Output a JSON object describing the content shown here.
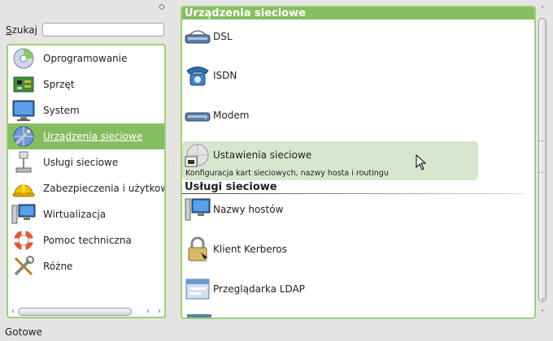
{
  "left_panel": {
    "search_label": "Szukaj",
    "search_value": "",
    "categories": [
      {
        "label": "Oprogramowanie",
        "icon": "software-disc-icon"
      },
      {
        "label": "Sprzęt",
        "icon": "hardware-board-icon"
      },
      {
        "label": "System",
        "icon": "monitor-icon"
      },
      {
        "label": "Urządzenia sieciowe",
        "icon": "network-globe-icon",
        "selected": true
      },
      {
        "label": "Usługi sieciowe",
        "icon": "network-services-icon"
      },
      {
        "label": "Zabezpieczenia i użytkow",
        "icon": "security-helmet-icon"
      },
      {
        "label": "Wirtualizacja",
        "icon": "virtualization-icon"
      },
      {
        "label": "Pomoc techniczna",
        "icon": "lifebuoy-icon"
      },
      {
        "label": "Różne",
        "icon": "tools-icon"
      }
    ]
  },
  "right_panel": {
    "section1": {
      "title": "Urządzenia sieciowe",
      "items": [
        {
          "label": "DSL",
          "icon": "dsl-modem-icon"
        },
        {
          "label": "ISDN",
          "icon": "isdn-phone-icon"
        },
        {
          "label": "Modem",
          "icon": "modem-icon"
        },
        {
          "label": "Ustawienia sieciowe",
          "icon": "network-settings-icon",
          "description": "Konfiguracja kart sieciowych, nazwy hosta i routingu"
        }
      ]
    },
    "section2": {
      "title": "Usługi sieciowe",
      "items": [
        {
          "label": "Nazwy hostów",
          "icon": "hostnames-icon"
        },
        {
          "label": "Klient Kerberos",
          "icon": "kerberos-lock-icon"
        },
        {
          "label": "Przeglądarka LDAP",
          "icon": "ldap-browser-icon"
        }
      ]
    }
  },
  "status": {
    "text": "Gotowe"
  },
  "colors": {
    "accent": "#86bd61",
    "border": "#9cd17c",
    "hover": "#d6e6cf"
  }
}
